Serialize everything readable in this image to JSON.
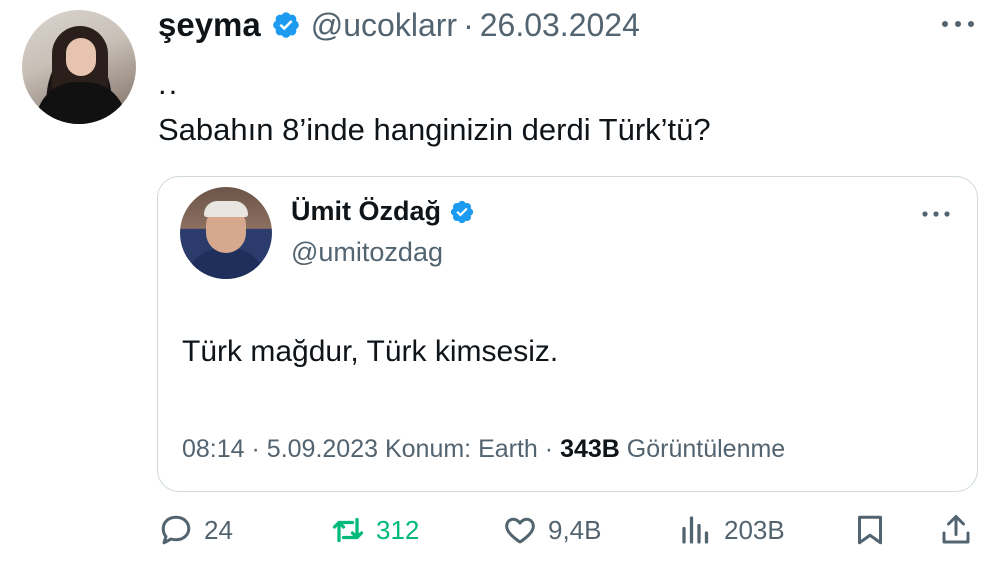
{
  "tweet": {
    "author": {
      "name": "şeyma",
      "handle": "@ucoklarr"
    },
    "separator": "·",
    "date": "26.03.2024",
    "line1": "..",
    "line2": "Sabahın 8’inde hanginizin derdi Türk’tü?"
  },
  "quoted": {
    "author": {
      "name": "Ümit Özdağ",
      "handle": "@umitozdag"
    },
    "text": "Türk mağdur, Türk kimsesiz.",
    "meta": {
      "time": "08:14",
      "sep1": "·",
      "date": "5.09.2023",
      "location": "Konum: Earth",
      "sep2": "·",
      "views": "343B",
      "views_label": "Görüntülenme"
    }
  },
  "actions": {
    "reply_count": "24",
    "retweet_count": "312",
    "like_count": "9,4B",
    "view_count": "203B"
  },
  "colors": {
    "verified": "#1d9bf0",
    "retweet": "#00ba7c",
    "secondary_text": "#536471"
  },
  "icons": [
    "verified-badge-icon",
    "more-icon",
    "reply-icon",
    "retweet-icon",
    "like-icon",
    "views-icon",
    "bookmark-icon",
    "share-icon"
  ]
}
